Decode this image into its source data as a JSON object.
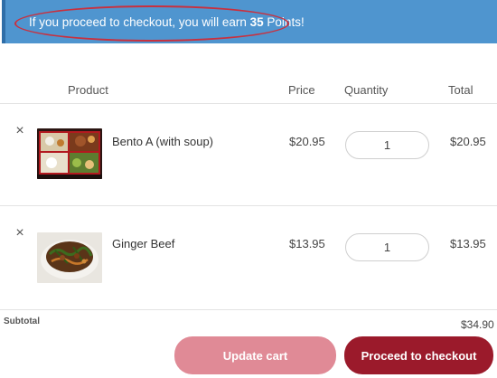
{
  "notice": {
    "text_before": "If you proceed to checkout, you will earn ",
    "points": "35",
    "text_after": " Points!"
  },
  "table": {
    "headers": {
      "product": "Product",
      "price": "Price",
      "quantity": "Quantity",
      "total": "Total"
    },
    "rows": [
      {
        "remove": "×",
        "name": "Bento A (with soup)",
        "price": "$20.95",
        "quantity": "1",
        "total": "$20.95",
        "image": "bento-box-photo"
      },
      {
        "remove": "×",
        "name": "Ginger Beef",
        "price": "$13.95",
        "quantity": "1",
        "total": "$13.95",
        "image": "ginger-beef-photo"
      }
    ]
  },
  "subtotal": {
    "label": "Subtotal",
    "value": "$34.90"
  },
  "buttons": {
    "update": "Update cart",
    "checkout": "Proceed to checkout"
  },
  "colors": {
    "notice_bg": "#4f95cf",
    "highlight_ellipse": "#c9303e",
    "update_button": "#e08a96",
    "checkout_button": "#9b1a2b"
  }
}
